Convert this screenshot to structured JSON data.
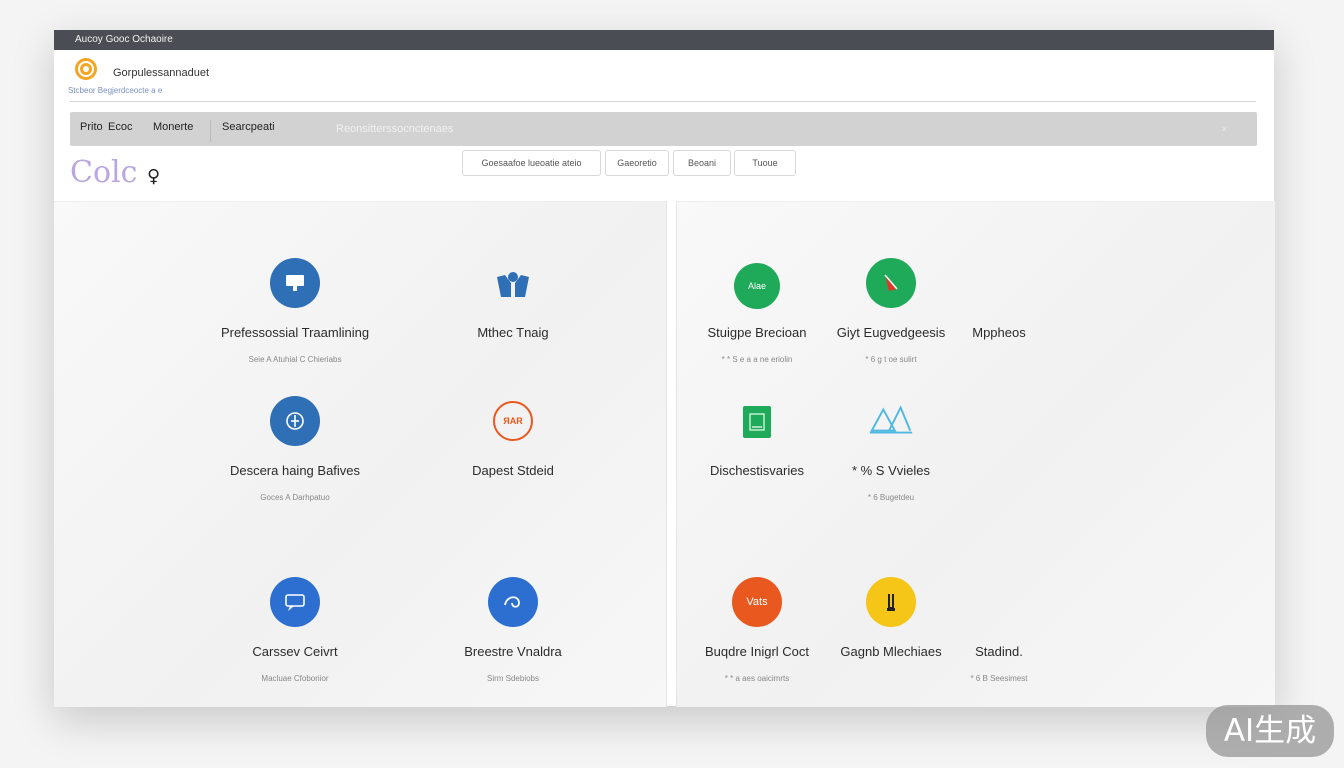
{
  "window": {
    "title": "Aucoy Gooc Ochaoire"
  },
  "brand": {
    "name": "Gorpulessannaduet",
    "subtitle": "Stcbeor Begjerdceocte a e"
  },
  "nav": {
    "items": [
      "Prito",
      "Ecoc",
      "Monerte",
      "Searcpeati"
    ],
    "search_text": "Reonsitterssocnctenaes",
    "close_glyph": "×"
  },
  "sub_logo_text": "Colc",
  "chips": [
    "Goesaafoe lueoatie ateio",
    "Gaeoretio",
    "Beoani",
    "Tuoue"
  ],
  "left_tiles": [
    {
      "title": "Prefessossial Traamlining",
      "sub": "Seie A Atuhial C Chieriabs"
    },
    {
      "title": "Mthec Tnaig",
      "sub": ""
    },
    {
      "title": "Descera haing Bafives",
      "sub": "Goces A Darhpatuo"
    },
    {
      "title": "Dapest Stdeid",
      "sub": ""
    },
    {
      "title": "Carssev Ceivrt",
      "sub": "Macluae Cfoboriior"
    },
    {
      "title": "Breestre Vnaldra",
      "sub": "Sirm Sdebiobs"
    }
  ],
  "right_tiles": [
    {
      "title": "Stuigpe Brecioan",
      "sub": "* * S e a a ne eriolin"
    },
    {
      "title": "Giyt Eugvedgeesis",
      "sub": "* 6 g t oe sulirt"
    },
    {
      "title": "Mppheos",
      "sub": ""
    },
    {
      "title": "Dischestisvaries",
      "sub": ""
    },
    {
      "title": "* % S Vvieles",
      "sub": "* 6 Bugetdeu"
    },
    {
      "title": "Buqdre Inigrl Coct",
      "sub": "* * a aes oaicimrts"
    },
    {
      "title": "Gagnb Mlechiaes",
      "sub": ""
    },
    {
      "title": "Stadind.",
      "sub": "* 6 B Seesimest"
    }
  ],
  "icon_text": {
    "rt1": "Alae",
    "lt4": "ЯAR",
    "rt6": "Vats"
  },
  "badge": "AI生成",
  "colors": {
    "blue": "#2f6fb5",
    "green": "#1faa59",
    "orange": "#e8581f",
    "yellow": "#f5c518",
    "header": "#4a4d53",
    "nav": "#d2d2d2"
  }
}
